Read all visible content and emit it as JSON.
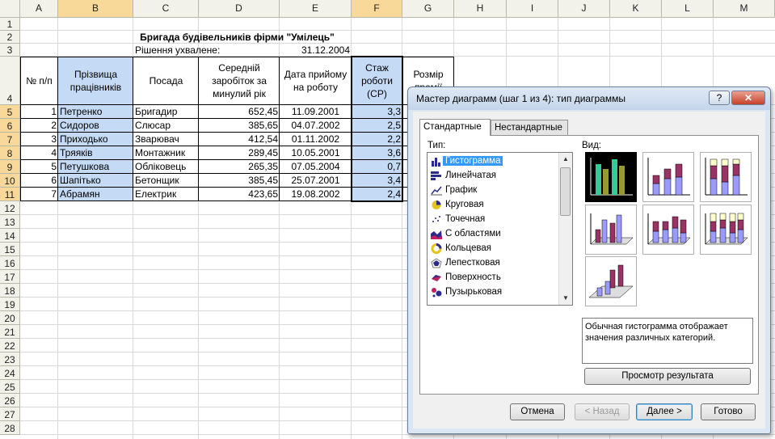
{
  "columns": [
    "A",
    "B",
    "C",
    "D",
    "E",
    "F",
    "G",
    "H",
    "I",
    "J",
    "K",
    "L",
    "M"
  ],
  "rows": [
    "1",
    "2",
    "3",
    "4",
    "5",
    "6",
    "7",
    "8",
    "9",
    "10",
    "11",
    "12",
    "13",
    "14",
    "15",
    "16",
    "17",
    "18",
    "19",
    "20",
    "21",
    "22",
    "23",
    "24",
    "25",
    "26",
    "27",
    "28"
  ],
  "sheet": {
    "title": "Бригада будівельників фірми \"Умілець\"",
    "decision_label": "Рішення ухвалене:",
    "decision_date": "31.12.2004",
    "headers": {
      "num": "№ п/п",
      "surname": "Прізвища працівників",
      "position": "Посада",
      "salary": "Середній заробіток за минулий рік",
      "hire_date": "Дата прийому на роботу",
      "tenure": "Стаж роботи (СР)",
      "bonus": "Розмір премії"
    },
    "data": [
      [
        "1",
        "Петренко",
        "Бригадир",
        "652,45",
        "11.09.2001",
        "3,3"
      ],
      [
        "2",
        "Сидоров",
        "Слюсар",
        "385,65",
        "04.07.2002",
        "2,5"
      ],
      [
        "3",
        "Приходько",
        "Зварювач",
        "412,54",
        "01.11.2002",
        "2,2"
      ],
      [
        "4",
        "Тряяків",
        "Монтажник",
        "289,45",
        "10.05.2001",
        "3,6"
      ],
      [
        "5",
        "Петушкова",
        "Обліковець",
        "265,35",
        "07.05.2004",
        "0,7"
      ],
      [
        "6",
        "Шапітько",
        "Бетонщик",
        "385,45",
        "25.07.2001",
        "3,4"
      ],
      [
        "7",
        "Абрамян",
        "Електрик",
        "423,65",
        "19.08.2002",
        "2,4"
      ]
    ]
  },
  "dialog": {
    "title": "Мастер диаграмм (шаг 1 из 4): тип диаграммы",
    "help": "?",
    "close": "✕",
    "tabs": [
      "Стандартные",
      "Нестандартные"
    ],
    "type_label": "Тип:",
    "view_label": "Вид:",
    "chart_types": [
      {
        "name": "Гистограмма",
        "icon": "column-chart-icon"
      },
      {
        "name": "Линейчатая",
        "icon": "bar-chart-icon"
      },
      {
        "name": "График",
        "icon": "line-chart-icon"
      },
      {
        "name": "Круговая",
        "icon": "pie-chart-icon"
      },
      {
        "name": "Точечная",
        "icon": "scatter-chart-icon"
      },
      {
        "name": "С областями",
        "icon": "area-chart-icon"
      },
      {
        "name": "Кольцевая",
        "icon": "doughnut-chart-icon"
      },
      {
        "name": "Лепестковая",
        "icon": "radar-chart-icon"
      },
      {
        "name": "Поверхность",
        "icon": "surface-chart-icon"
      },
      {
        "name": "Пузырьковая",
        "icon": "bubble-chart-icon"
      }
    ],
    "description": "Обычная гистограмма отображает значения различных категорий.",
    "preview_button": "Просмотр результата",
    "cancel": "Отмена",
    "back": "< Назад",
    "next": "Далее >",
    "finish": "Готово",
    "colors": {
      "bar_blue": "#9a9aff",
      "bar_maroon": "#993366",
      "bar_cream": "#ffffcc",
      "teal": "#33cc99",
      "olive": "#999933"
    }
  }
}
